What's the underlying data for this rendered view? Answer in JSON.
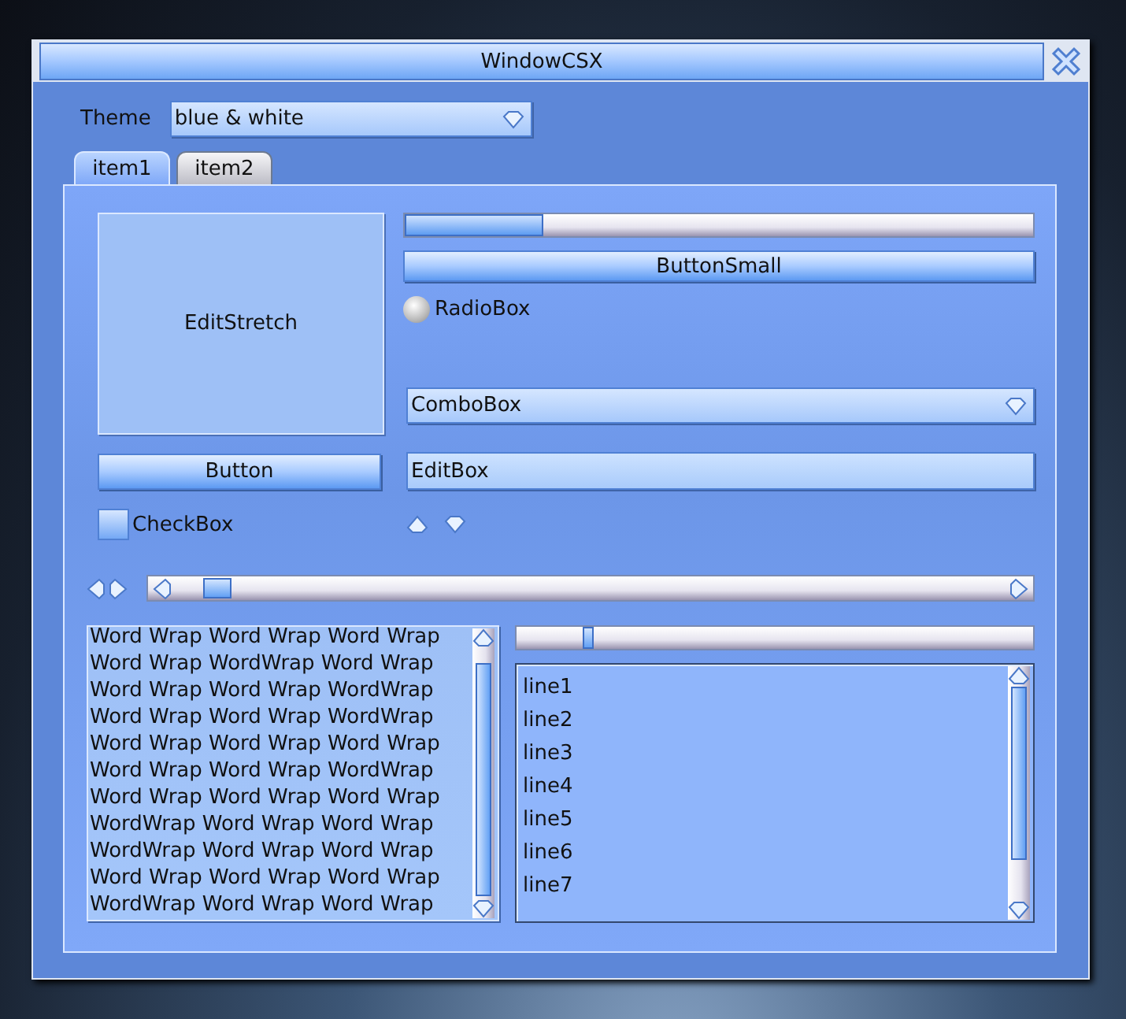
{
  "window": {
    "title": "WindowCSX"
  },
  "theme": {
    "label": "Theme",
    "value": "blue & white"
  },
  "tabs": [
    {
      "label": "item1",
      "selected": true
    },
    {
      "label": "item2",
      "selected": false
    }
  ],
  "edit_stretch": {
    "value": "EditStretch"
  },
  "progress": {
    "level": 0.22
  },
  "button_small": "ButtonSmall",
  "radio": {
    "label": "RadioBox",
    "selected": false
  },
  "combo": {
    "value": "ComboBox"
  },
  "button": "Button",
  "edit_box": {
    "value": "EditBox"
  },
  "checkbox": {
    "label": "CheckBox",
    "checked": false
  },
  "slider": {
    "level": 0.12
  },
  "text_area": {
    "lines": [
      "Word Wrap Word Wrap Word Wrap",
      "Word Wrap WordWrap Word Wrap",
      "Word Wrap Word Wrap WordWrap",
      "Word Wrap Word Wrap WordWrap",
      "Word Wrap Word Wrap Word Wrap",
      "Word Wrap Word Wrap WordWrap",
      "Word Wrap Word Wrap Word Wrap",
      "WordWrap Word Wrap Word Wrap",
      "WordWrap Word Wrap Word Wrap",
      "Word Wrap Word Wrap Word Wrap",
      "WordWrap Word Wrap Word Wrap"
    ]
  },
  "list_box": {
    "items": [
      "line1",
      "line2",
      "line3",
      "line4",
      "line5",
      "line6",
      "line7"
    ]
  }
}
